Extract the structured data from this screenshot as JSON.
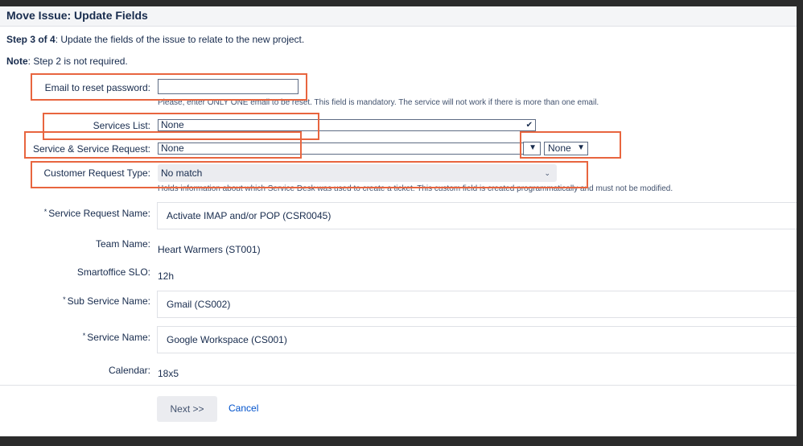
{
  "dialog": {
    "title": "Move Issue: Update Fields",
    "step_label": "Step 3 of 4",
    "step_text": ": Update the fields of the issue to relate to the new project.",
    "note_label": "Note",
    "note_text": ": Step 2 is not required."
  },
  "fields": {
    "email_reset": {
      "label": "Email to reset password:",
      "value": "",
      "description": "Please, enter ONLY ONE email to be reset. This field is mandatory. The service will not work if there is more than one email."
    },
    "services_list": {
      "label": "Services List:",
      "selected": "None"
    },
    "service_request": {
      "label": "Service & Service Request:",
      "selected": "None",
      "secondary_selected": "None"
    },
    "customer_request_type": {
      "label": "Customer Request Type:",
      "selected": "No match",
      "description": "Holds information about which Service Desk was used to create a ticket. This custom field is created programmatically and must not be modified."
    },
    "service_request_name": {
      "label": "Service Request Name:",
      "required_mark": "*",
      "value": "Activate IMAP and/or POP (CSR0045)"
    },
    "team_name": {
      "label": "Team Name:",
      "value": "Heart Warmers (ST001)"
    },
    "smartoffice_slo": {
      "label": "Smartoffice SLO:",
      "value": "12h"
    },
    "sub_service_name": {
      "label": "Sub Service Name:",
      "required_mark": "*",
      "value": "Gmail (CS002)"
    },
    "service_name": {
      "label": "Service Name:",
      "required_mark": "*",
      "value": "Google Workspace (CS001)"
    },
    "calendar": {
      "label": "Calendar:",
      "value": "18x5"
    }
  },
  "actions": {
    "next_label": "Next >>",
    "cancel_label": "Cancel"
  },
  "icons": {
    "caret": "chevron-down-icon"
  },
  "colors": {
    "highlight": "#e8653f",
    "link": "#0052cc",
    "title_bar": "#f4f5f7"
  }
}
